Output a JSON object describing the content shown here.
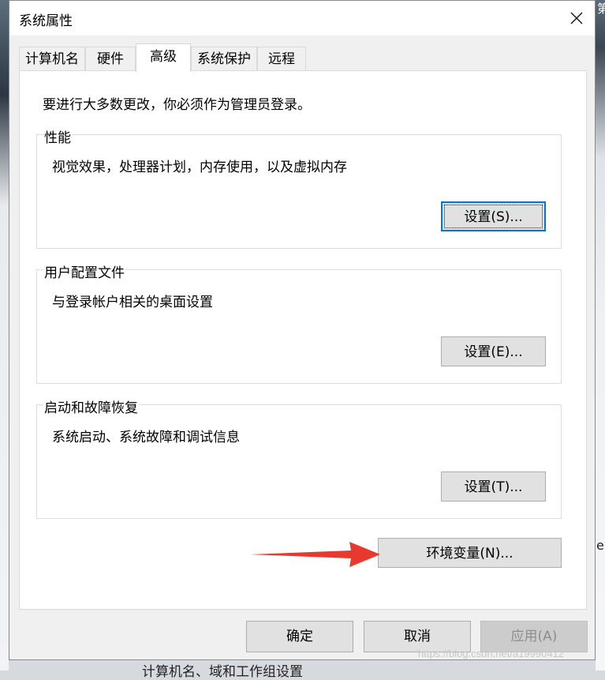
{
  "window": {
    "title": "系统属性"
  },
  "tabs": [
    {
      "label": "计算机名"
    },
    {
      "label": "硬件"
    },
    {
      "label": "高级"
    },
    {
      "label": "系统保护"
    },
    {
      "label": "远程"
    }
  ],
  "active_tab": "高级",
  "intro_text": "要进行大多数更改，你必须作为管理员登录。",
  "groups": [
    {
      "title": "性能",
      "description": "视觉效果，处理器计划，内存使用，以及虚拟内存",
      "button": "设置(S)..."
    },
    {
      "title": "用户配置文件",
      "description": "与登录帐户相关的桌面设置",
      "button": "设置(E)..."
    },
    {
      "title": "启动和故障恢复",
      "description": "系统启动、系统故障和调试信息",
      "button": "设置(T)..."
    }
  ],
  "env_button": "环境变量(N)...",
  "footer": {
    "ok": "确定",
    "cancel": "取消",
    "apply": "应用(A)"
  },
  "background": {
    "bottom_text": "计算机名、域和工作组设置",
    "right_top_text": "第",
    "right_mid_text": "e",
    "watermark": "https://blog.csdn.net/a19990412"
  },
  "colors": {
    "accent": "#0078d7",
    "arrow": "#e8392f"
  },
  "icons": {
    "close": "close-icon",
    "arrow": "red-arrow-annotation"
  }
}
